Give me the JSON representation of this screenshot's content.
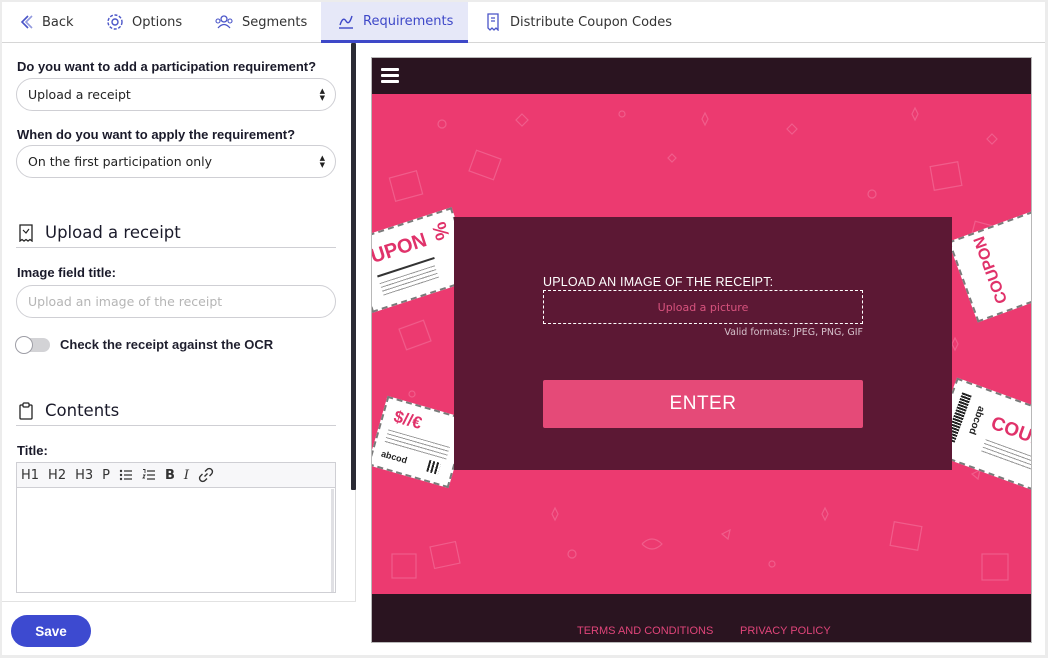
{
  "nav": {
    "back": "Back",
    "options": "Options",
    "segments": "Segments",
    "requirements": "Requirements",
    "distribute": "Distribute Coupon Codes"
  },
  "form": {
    "participation_question": "Do you want to add a participation requirement?",
    "participation_value": "Upload a receipt",
    "apply_question": "When do you want to apply the requirement?",
    "apply_value": "On the first participation only",
    "upload_section_title": "Upload a receipt",
    "image_field_label": "Image field title:",
    "image_field_placeholder": "Upload an image of the receipt",
    "ocr_toggle_label": "Check the receipt against the OCR",
    "ocr_toggle_on": false,
    "contents_section_title": "Contents",
    "title_label": "Title:",
    "toolbar": [
      "H1",
      "H2",
      "H3",
      "P"
    ],
    "save_label": "Save"
  },
  "preview": {
    "upload_label": "UPLOAD AN IMAGE OF THE RECEIPT:",
    "upload_placeholder": "Upload a picture",
    "formats": "Valid formats: JPEG, PNG, GIF",
    "enter": "ENTER",
    "terms": "TERMS AND CONDITIONS",
    "privacy": "PRIVACY POLICY",
    "coupon_tl": "UPON",
    "coupon_tl_sym": "%",
    "coupon_bl": "$//€",
    "coupon_bl_code": "abcod",
    "coupon_tr": "COUPON",
    "coupon_br": "COUP",
    "coupon_br_code": "abcod"
  },
  "colors": {
    "accent": "#3d4ad0",
    "preview_bg": "#ec3a70",
    "card_bg": "#5c1834",
    "button": "#e54a78"
  }
}
